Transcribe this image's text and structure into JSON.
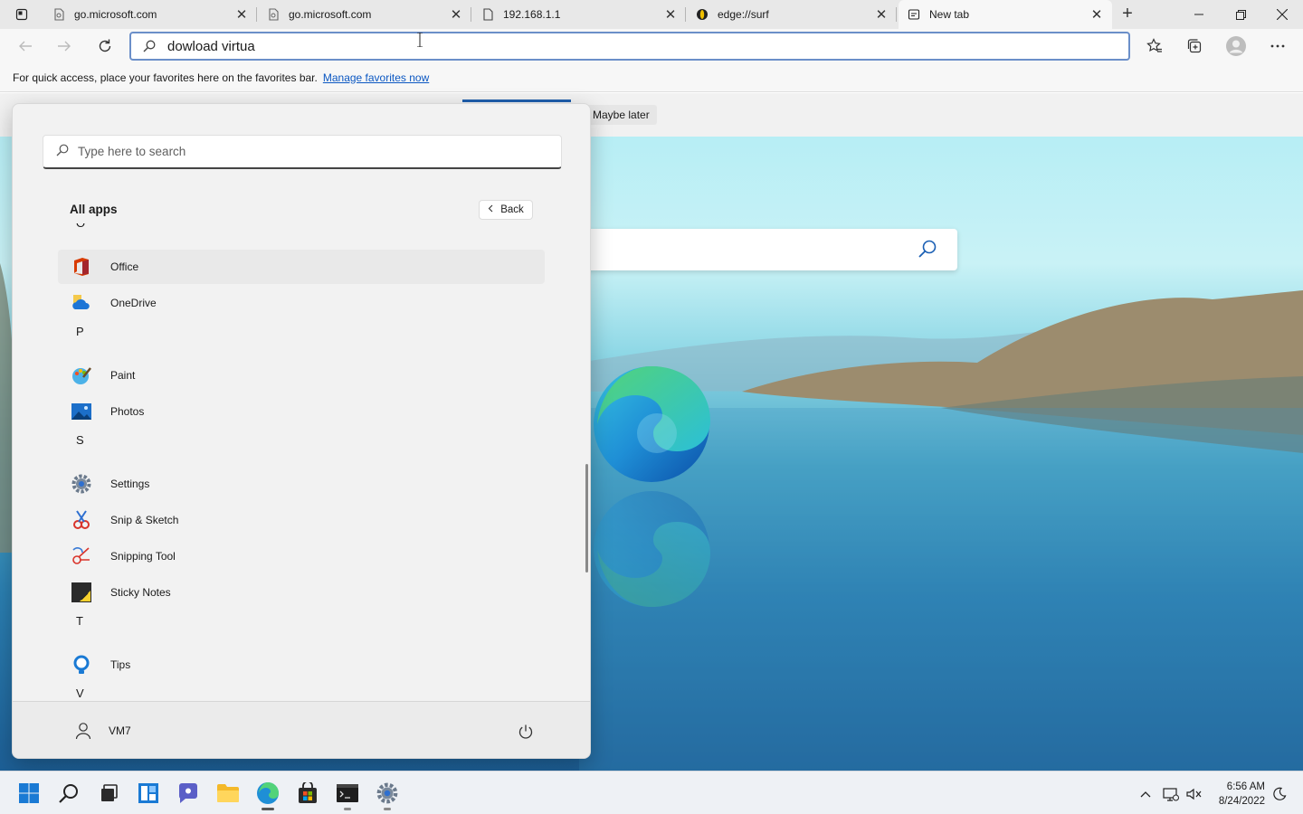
{
  "browser": {
    "tabs": [
      {
        "title": "go.microsoft.com",
        "icon": "page-icon"
      },
      {
        "title": "go.microsoft.com",
        "icon": "page-icon"
      },
      {
        "title": "192.168.1.1",
        "icon": "document-icon"
      },
      {
        "title": "edge://surf",
        "icon": "surf-icon"
      },
      {
        "title": "New tab",
        "icon": "newtab-icon"
      }
    ],
    "address": "dowload virtua",
    "favorites_bar": {
      "text": "For quick access, place your favorites here on the favorites bar.",
      "link": "Manage favorites now"
    }
  },
  "page": {
    "maybe_later": "Maybe later"
  },
  "start_menu": {
    "search_placeholder": "Type here to search",
    "all_apps_title": "All apps",
    "back_label": "Back",
    "sections": [
      {
        "letter": "O",
        "apps": [
          "Office",
          "OneDrive"
        ]
      },
      {
        "letter": "P",
        "apps": [
          "Paint",
          "Photos"
        ]
      },
      {
        "letter": "S",
        "apps": [
          "Settings",
          "Snip & Sketch",
          "Snipping Tool",
          "Sticky Notes"
        ]
      },
      {
        "letter": "T",
        "apps": [
          "Tips"
        ]
      },
      {
        "letter": "V",
        "apps": []
      }
    ],
    "user_name": "VM7"
  },
  "taskbar": {
    "time": "6:56 AM",
    "date": "8/24/2022"
  },
  "colors": {
    "accent": "#0b57c2",
    "address_border": "#6b8fc9",
    "start_bg": "#f2f2f2",
    "taskbar_bg": "#eef1f5"
  }
}
